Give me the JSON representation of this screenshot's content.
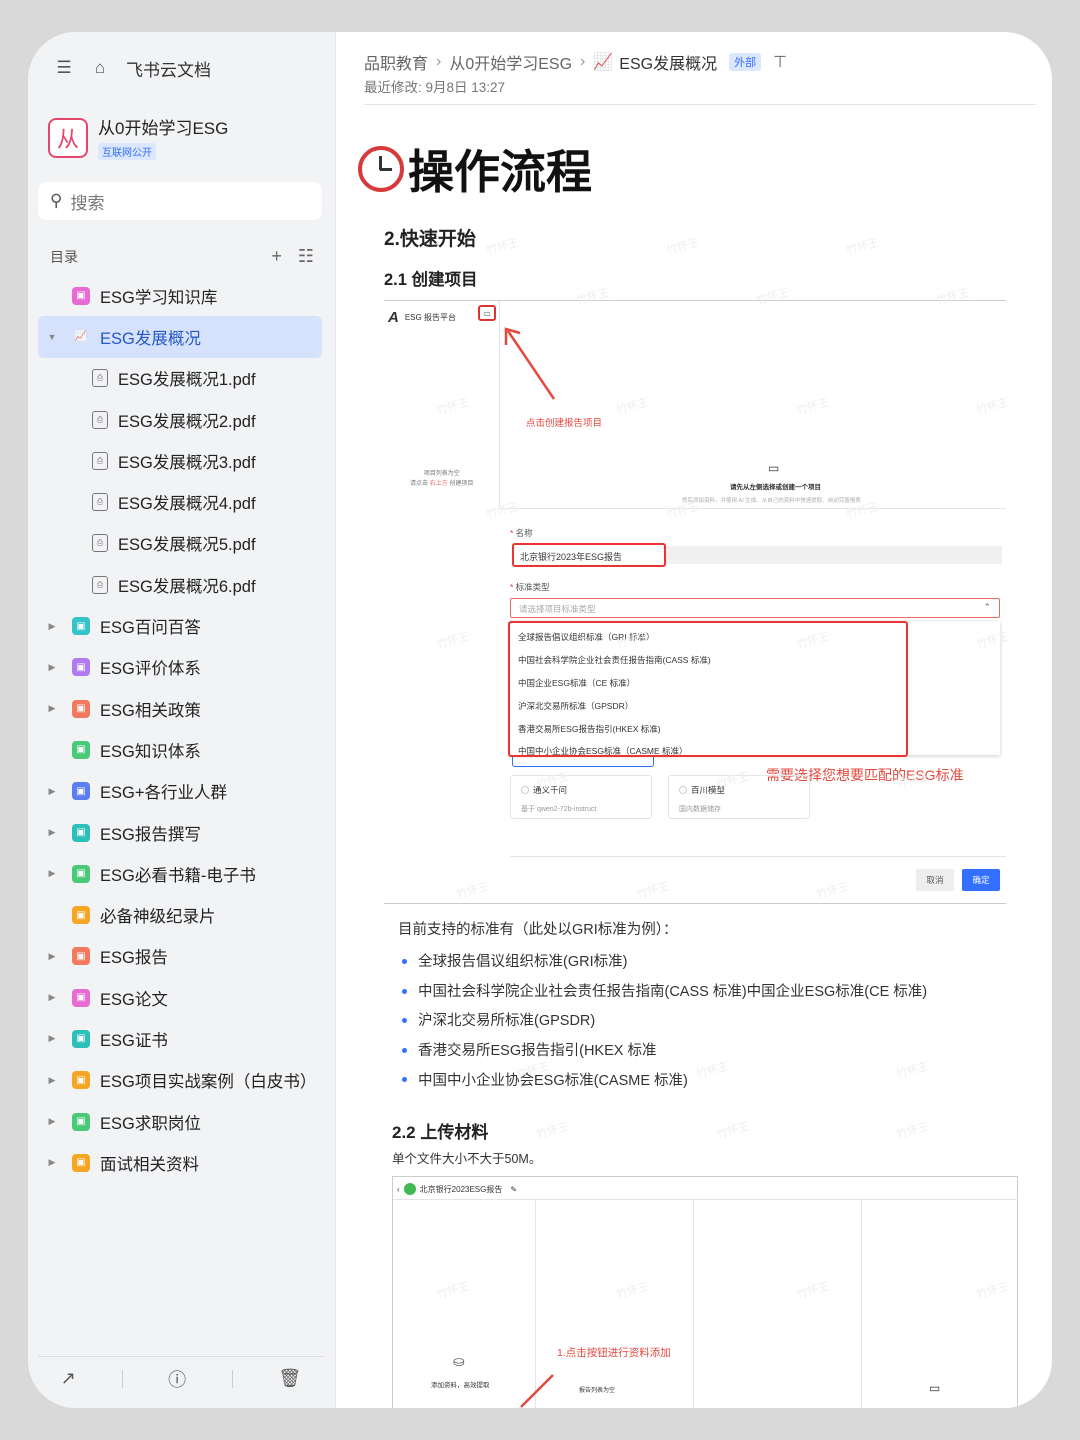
{
  "sidebar": {
    "app_title": "飞书云文档",
    "space": {
      "name": "从0开始学习ESG",
      "logo_char": "从",
      "tag": "互联网公开"
    },
    "search_placeholder": "搜索",
    "toc_label": "目录",
    "tree": [
      {
        "label": "ESG学习知识库",
        "color": "#e86ad3",
        "caret": ""
      },
      {
        "label": "ESG发展概况",
        "color": "#7b8fbf",
        "caret": "▼",
        "active": true
      },
      {
        "label": "ESG发展概况1.pdf",
        "child": true
      },
      {
        "label": "ESG发展概况2.pdf",
        "child": true
      },
      {
        "label": "ESG发展概况3.pdf",
        "child": true
      },
      {
        "label": "ESG发展概况4.pdf",
        "child": true
      },
      {
        "label": "ESG发展概况5.pdf",
        "child": true
      },
      {
        "label": "ESG发展概况6.pdf",
        "child": true
      },
      {
        "label": "ESG百问百答",
        "color": "#34c3c9",
        "caret": "▶"
      },
      {
        "label": "ESG评价体系",
        "color": "#b07bf0",
        "caret": "▶"
      },
      {
        "label": "ESG相关政策",
        "color": "#f2795f",
        "caret": "▶"
      },
      {
        "label": "ESG知识体系",
        "color": "#4bc97a",
        "caret": ""
      },
      {
        "label": "ESG+各行业人群",
        "color": "#5b7ff0",
        "caret": "▶"
      },
      {
        "label": "ESG报告撰写",
        "color": "#2dbfb9",
        "caret": "▶"
      },
      {
        "label": "ESG必看书籍-电子书",
        "color": "#4bc97a",
        "caret": "▶"
      },
      {
        "label": "必备神级纪录片",
        "color": "#f5a623",
        "caret": ""
      },
      {
        "label": "ESG报告",
        "color": "#f2795f",
        "caret": "▶"
      },
      {
        "label": "ESG论文",
        "color": "#e86ad3",
        "caret": "▶"
      },
      {
        "label": "ESG证书",
        "color": "#2dbfb9",
        "caret": "▶"
      },
      {
        "label": "ESG项目实战案例（白皮书）",
        "color": "#f5a623",
        "caret": "▶"
      },
      {
        "label": "ESG求职岗位",
        "color": "#4bc97a",
        "caret": "▶"
      },
      {
        "label": "面试相关资料",
        "color": "#f5a623",
        "caret": "▶"
      }
    ]
  },
  "header": {
    "crumb1": "品职教育",
    "crumb2": "从0开始学习ESG",
    "crumb3": "ESG发展概况",
    "tag": "外部",
    "modified": "最近修改: 9月8日 13:27"
  },
  "doc": {
    "title": "操作流程",
    "h2": "2.快速开始",
    "h3_1": "2.1 创建项目",
    "shot1": {
      "platform": "ESG 报告平台",
      "empty_line1": "项目列表为空",
      "empty_line2a": "请点击",
      "empty_line2b": "右上方",
      "empty_line2c": "创建项目",
      "hint1": "点击创建报告项目",
      "center_title": "请先从左侧选择或创建一个项目",
      "center_sub": "然后添加资料，并使用 AI 生成、从自己的资料中快速提取、自动完善报表",
      "name_label": "名称",
      "name_value": "北京银行2023年ESG报告",
      "type_label": "标准类型",
      "type_placeholder": "请选择项目标准类型",
      "options": [
        "全球报告倡议组织标准（GRI 标准）",
        "中国社会科学院企业社会责任报告指南(CASS 标准)",
        "中国企业ESG标准（CE 标准）",
        "沪深北交易所标准（GPSDR）",
        "香港交易所ESG报告指引(HKEX 标准)",
        "中国中小企业协会ESG标准（CASME 标准）"
      ],
      "hint2": "需要选择您想要匹配的ESG标准",
      "card1_title": "通义千问",
      "card1_sub": "基于 qwen2-72b-instruct",
      "card2_title": "百川模型",
      "card2_sub": "国内数据储存",
      "cancel": "取消",
      "ok": "确定"
    },
    "para": "目前支持的标准有（此处以GRI标准为例）：",
    "list": [
      "全球报告倡议组织标准(GRI标准)",
      "中国社会科学院企业社会责任报告指南(CASS 标准)中国企业ESG标准(CE 标准)",
      "沪深北交易所标准(GPSDR)",
      "香港交易所ESG报告指引(HKEX 标准",
      "中国中小企业协会ESG标准(CASME 标准)"
    ],
    "h3_2": "2.2 上传材料",
    "note": "单个文件大小不大于50M。",
    "shot2": {
      "project": "北京银行2023ESG报告",
      "add": "添加资料，高效提取",
      "hint": "1.点击按钮进行资料添加",
      "empty": "报告列表为空"
    }
  },
  "watermark": "竹怀王"
}
